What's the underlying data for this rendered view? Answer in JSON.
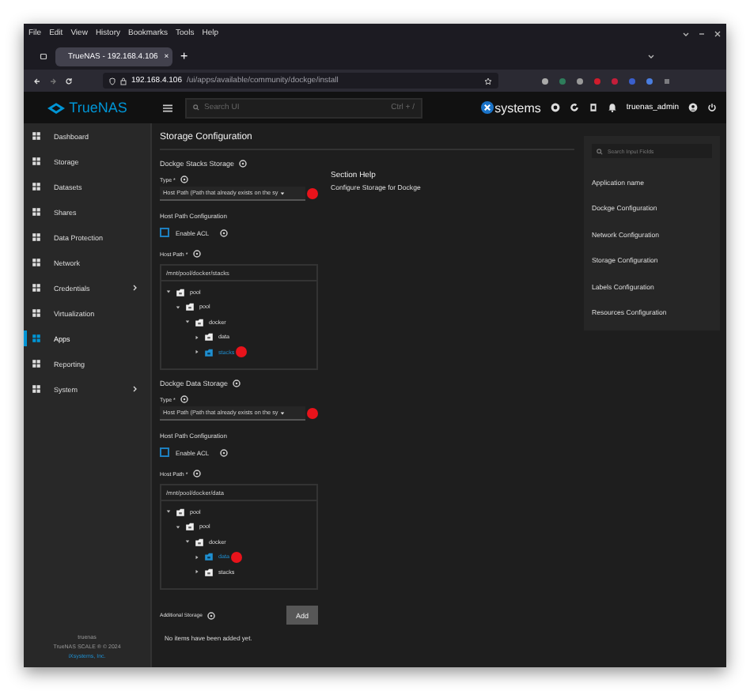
{
  "browser": {
    "menu": [
      "File",
      "Edit",
      "View",
      "History",
      "Bookmarks",
      "Tools",
      "Help"
    ],
    "tab": {
      "title": "TrueNAS - 192.168.4.106",
      "close": "×"
    },
    "new_tab": "+",
    "url_host": "192.168.4.106",
    "url_path": "/ui/apps/available/community/dockge/install"
  },
  "topbar": {
    "logo": "TrueNAS",
    "search": {
      "placeholder": "Search UI",
      "shortcut": "Ctrl + /"
    },
    "vendor": "systems",
    "user": "truenas_admin"
  },
  "sidebar": {
    "items": [
      {
        "label": "Dashboard",
        "selected": false,
        "has_children": false
      },
      {
        "label": "Storage",
        "selected": false,
        "has_children": false
      },
      {
        "label": "Datasets",
        "selected": false,
        "has_children": false
      },
      {
        "label": "Shares",
        "selected": false,
        "has_children": false
      },
      {
        "label": "Data Protection",
        "selected": false,
        "has_children": false
      },
      {
        "label": "Network",
        "selected": false,
        "has_children": false
      },
      {
        "label": "Credentials",
        "selected": false,
        "has_children": true
      },
      {
        "label": "Virtualization",
        "selected": false,
        "has_children": false
      },
      {
        "label": "Apps",
        "selected": true,
        "has_children": false
      },
      {
        "label": "Reporting",
        "selected": false,
        "has_children": false
      },
      {
        "label": "System",
        "selected": false,
        "has_children": true
      }
    ],
    "footer": {
      "host": "truenas",
      "copyright": "TrueNAS SCALE ® © 2024",
      "company": "iXsystems, Inc."
    }
  },
  "form": {
    "title": "Storage Configuration",
    "sections": [
      {
        "title": "Dockge Stacks Storage",
        "type_label": "Type *",
        "type_value": "Host Path (Path that already exists on the sy",
        "marked": true,
        "config_title": "Host Path Configuration",
        "acl": {
          "label": "Enable ACL",
          "checked": false
        },
        "path_label": "Host Path *",
        "path_value": "/mnt/pool/docker/stacks",
        "tree": [
          {
            "label": "pool",
            "expanded": true,
            "selected": false,
            "marked": false,
            "children": [
              {
                "label": "pool",
                "expanded": true,
                "selected": false,
                "marked": false,
                "children": [
                  {
                    "label": "docker",
                    "expanded": true,
                    "selected": false,
                    "marked": false,
                    "children": [
                      {
                        "label": "data",
                        "expanded": false,
                        "selected": false,
                        "marked": false
                      },
                      {
                        "label": "stacks",
                        "expanded": false,
                        "selected": true,
                        "marked": true
                      }
                    ]
                  }
                ]
              }
            ]
          }
        ]
      },
      {
        "title": "Dockge Data Storage",
        "type_label": "Type *",
        "type_value": "Host Path (Path that already exists on the sy",
        "marked": true,
        "config_title": "Host Path Configuration",
        "acl": {
          "label": "Enable ACL",
          "checked": false
        },
        "path_label": "Host Path *",
        "path_value": "/mnt/pool/docker/data",
        "tree": [
          {
            "label": "pool",
            "expanded": true,
            "selected": false,
            "marked": false,
            "children": [
              {
                "label": "pool",
                "expanded": true,
                "selected": false,
                "marked": false,
                "children": [
                  {
                    "label": "docker",
                    "expanded": true,
                    "selected": false,
                    "marked": false,
                    "children": [
                      {
                        "label": "data",
                        "expanded": false,
                        "selected": true,
                        "marked": true
                      },
                      {
                        "label": "stacks",
                        "expanded": false,
                        "selected": false,
                        "marked": false
                      }
                    ]
                  }
                ]
              }
            ]
          }
        ]
      }
    ],
    "additional": {
      "label": "Additional Storage",
      "button": "Add",
      "empty": "No items have been added yet."
    }
  },
  "help": {
    "title": "Section Help",
    "text": "Configure Storage for Dockge"
  },
  "nav_panel": {
    "search": {
      "placeholder": "Search Input Fields"
    },
    "items": [
      "Application name",
      "Dockge Configuration",
      "Network Configuration",
      "Storage Configuration",
      "Labels Configuration",
      "Resources Configuration"
    ]
  }
}
